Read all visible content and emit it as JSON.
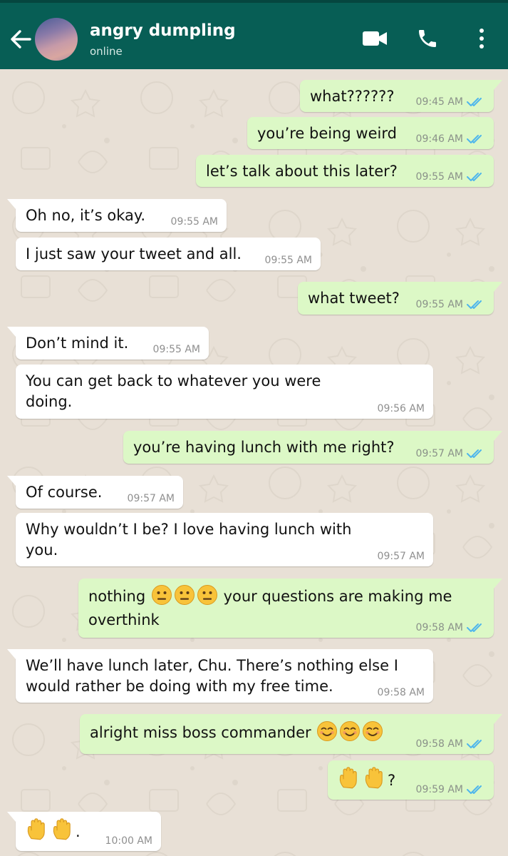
{
  "header": {
    "contact_name": "angry dumpling",
    "status": "online"
  },
  "icons": {
    "back": "arrow-left-icon",
    "video": "video-camera-icon",
    "call": "phone-icon",
    "menu": "more-vertical-icon",
    "read": "double-check-icon"
  },
  "colors": {
    "header": "#075e55",
    "outgoing_bubble": "#dcf8c6",
    "incoming_bubble": "#ffffff",
    "read_ticks": "#4fb6ec",
    "chat_background": "#e8e0d6"
  },
  "messages": [
    {
      "dir": "out",
      "text": "what??????",
      "time": "09:45 AM"
    },
    {
      "dir": "out",
      "text": "you’re being weird",
      "time": "09:46 AM"
    },
    {
      "dir": "out",
      "text": "let’s talk about this later?",
      "time": "09:55 AM"
    },
    {
      "dir": "in",
      "text": "Oh no, it’s okay.",
      "time": "09:55 AM"
    },
    {
      "dir": "in",
      "text": "I just saw your tweet and all.",
      "time": "09:55 AM"
    },
    {
      "dir": "out",
      "text": "what tweet?",
      "time": "09:55 AM"
    },
    {
      "dir": "in",
      "text": "Don’t mind it.",
      "time": "09:55 AM"
    },
    {
      "dir": "in",
      "text": "You can get back to whatever you were doing.",
      "time": "09:56 AM"
    },
    {
      "dir": "out",
      "text": "you’re having lunch with me right?",
      "time": "09:57 AM"
    },
    {
      "dir": "in",
      "text": "Of course.",
      "time": "09:57 AM"
    },
    {
      "dir": "in",
      "text": "Why wouldn’t I be? I love having lunch with you.",
      "time": "09:57 AM"
    },
    {
      "dir": "out",
      "text_before": "nothing",
      "emojis": [
        "neutral-face",
        "neutral-face",
        "neutral-face"
      ],
      "text_after": "your questions are making me overthink",
      "time": "09:58 AM"
    },
    {
      "dir": "in",
      "text": "We’ll have lunch later, Chu. There’s nothing else I would rather be doing with my free time.",
      "time": "09:58 AM"
    },
    {
      "dir": "out",
      "text_before": "alright miss boss commander",
      "emojis": [
        "smiling-face",
        "smiling-face",
        "smiling-face"
      ],
      "text_after": "",
      "time": "09:58 AM"
    },
    {
      "dir": "out",
      "text_before": "",
      "emojis": [
        "raised-hand",
        "raised-hand"
      ],
      "text_after": "?",
      "time": "09:59 AM"
    },
    {
      "dir": "in",
      "text_before": "",
      "emojis": [
        "raised-hand",
        "raised-hand"
      ],
      "text_after": ".",
      "time": "10:00 AM"
    }
  ]
}
